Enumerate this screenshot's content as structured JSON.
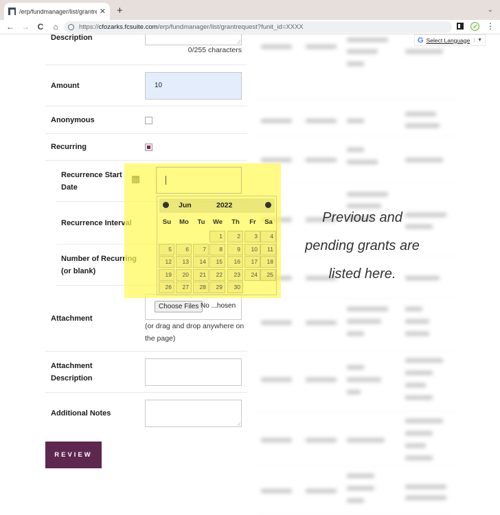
{
  "browser": {
    "tab_title": "/erp/fundmanager/list/grantreq",
    "url_scheme": "https://",
    "url_host": "cfozarks.fcsuite.com",
    "url_path": "/erp/fundmanager/list/grantrequest?funit_id=XXXX",
    "icons": {
      "back": "←",
      "forward": "→",
      "reload": "C",
      "home": "⌂",
      "new_tab": "+",
      "close_tab": "✕",
      "tab_menu": "⌄",
      "menu": "⋮",
      "extension": "✓"
    }
  },
  "form": {
    "description": {
      "label": "Description",
      "char_count": "0/255 characters"
    },
    "amount": {
      "label": "Amount",
      "value": "10"
    },
    "anonymous": {
      "label": "Anonymous",
      "checked": false
    },
    "recurring": {
      "label": "Recurring",
      "checked": true
    },
    "recurrence_start_date": {
      "label": "Recurrence Start Date",
      "value": ""
    },
    "recurrence_interval": {
      "label": "Recurrence Interval"
    },
    "number_of_recurring": {
      "label": "Number of Recurring (or blank)"
    },
    "attachment": {
      "label": "Attachment",
      "button": "Choose Files",
      "filename": "No ...hosen",
      "hint": "(or drag and drop anywhere on the page)"
    },
    "attachment_description": {
      "label": "Attachment Description",
      "value": ""
    },
    "additional_notes": {
      "label": "Additional Notes",
      "value": ""
    },
    "review_button": "REVIEW"
  },
  "datepicker": {
    "month": "Jun",
    "year": "2022",
    "weekdays": [
      "Su",
      "Mo",
      "Tu",
      "We",
      "Th",
      "Fr",
      "Sa"
    ],
    "first_weekday_index": 3,
    "days": [
      "1",
      "2",
      "3",
      "4",
      "5",
      "6",
      "7",
      "8",
      "9",
      "10",
      "11",
      "12",
      "13",
      "14",
      "15",
      "16",
      "17",
      "18",
      "19",
      "20",
      "21",
      "22",
      "23",
      "24",
      "25",
      "26",
      "27",
      "28",
      "29",
      "30"
    ]
  },
  "side_panel": {
    "note": "Previous and pending grants are listed here.",
    "language_selector": "Select Language",
    "language_icon": "G",
    "language_arrow": "▼"
  },
  "colors": {
    "brand": "#5e2750",
    "amount_bg": "#e3edfb",
    "highlight": "#fffa50"
  }
}
